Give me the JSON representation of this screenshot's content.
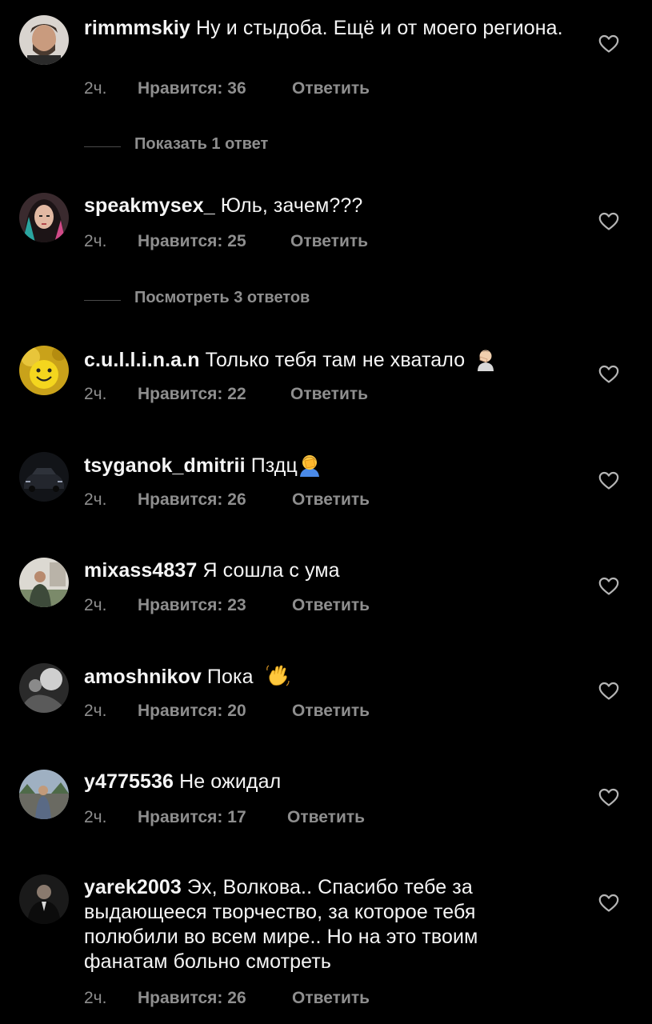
{
  "comments": [
    {
      "username": "rimmmskiy",
      "text": "Ну и стыдоба. Ещё и от моего региона.",
      "time": "2ч.",
      "likes": "Нравится: 36",
      "reply": "Ответить",
      "avatar_icon": "avatar-man-beard"
    },
    {
      "username": "speakmysex_",
      "text": "Юль, зачем???",
      "time": "2ч.",
      "likes": "Нравится: 25",
      "reply": "Ответить",
      "avatar_icon": "avatar-woman-colored-hair"
    },
    {
      "username": "c.u.l.l.i.n.a.n",
      "text": "Только тебя там не хватало",
      "emoji": "man-facepalming-emoji",
      "time": "2ч.",
      "likes": "Нравится: 22",
      "reply": "Ответить",
      "avatar_icon": "avatar-yellow-smiley"
    },
    {
      "username": "tsyganok_dmitrii",
      "text": "Пздц",
      "emoji": "facepalm-emoji",
      "time": "2ч.",
      "likes": "Нравится: 26",
      "reply": "Ответить",
      "avatar_icon": "avatar-dark-car"
    },
    {
      "username": "mixass4837",
      "text": "Я сошла с ума",
      "time": "2ч.",
      "likes": "Нравится: 23",
      "reply": "Ответить",
      "avatar_icon": "avatar-man-outdoors"
    },
    {
      "username": "amoshnikov",
      "text": "Пока",
      "emoji": "waving-hand-emoji",
      "time": "2ч.",
      "likes": "Нравится: 20",
      "reply": "Ответить",
      "avatar_icon": "avatar-grayscale"
    },
    {
      "username": "y4775536",
      "text": "Не ожидал",
      "time": "2ч.",
      "likes": "Нравится: 17",
      "reply": "Ответить",
      "avatar_icon": "avatar-man-street"
    },
    {
      "username": "yarek2003",
      "text": "Эх, Волкова.. Спасибо тебе за выдающееся творчество, за которое тебя полюбили во всем мире.. Но на это твоим фанатам больно смотреть",
      "time": "2ч.",
      "likes": "Нравится: 26",
      "reply": "Ответить",
      "avatar_icon": "avatar-man-suit"
    }
  ],
  "threads": [
    {
      "label": "Показать 1 ответ"
    },
    {
      "label": "Посмотреть 3 ответов"
    }
  ],
  "colors": {
    "background": "#000000",
    "text": "#f5f5f5",
    "secondary": "#8e8e8e"
  }
}
